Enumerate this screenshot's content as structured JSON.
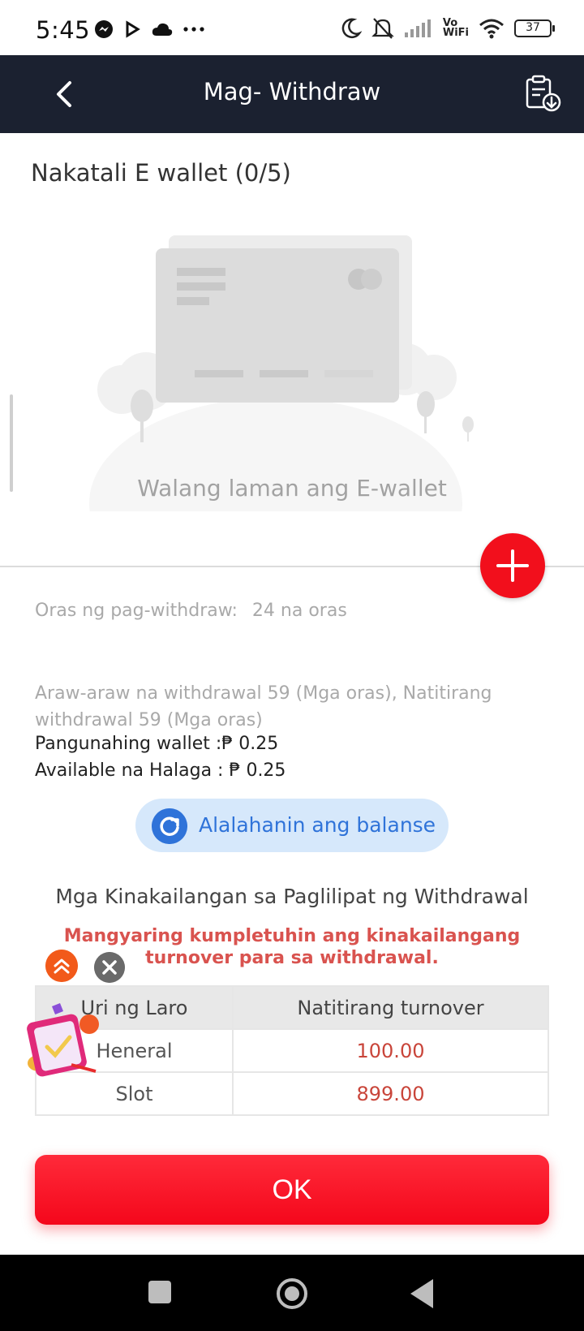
{
  "status_bar": {
    "time": "5:45",
    "left_icons": [
      "messenger-icon",
      "play-icon",
      "cloud-icon",
      "more-icon"
    ],
    "right_icons": [
      "moon-icon",
      "bell-off-icon",
      "signal-icon",
      "vowifi-icon",
      "wifi-icon",
      "battery-icon"
    ],
    "vowifi_label_top": "Vo",
    "vowifi_label_bottom": "WiFi",
    "battery": "37"
  },
  "header": {
    "title": "Mag- Withdraw",
    "back_icon": "chevron-left-icon",
    "record_icon": "clipboard-download-icon",
    "background": "#1b2130"
  },
  "wallet": {
    "title": "Nakatali E wallet (0/5)",
    "empty_text": "Walang laman ang E-wallet",
    "add_icon": "plus-icon",
    "accent": "#f20f1c"
  },
  "info": {
    "time_label": "Oras ng pag-withdraw:",
    "time_value": "24 na oras",
    "daily_text": "Araw-araw na withdrawal 59 (Mga oras), Natitirang withdrawal 59 (Mga oras)",
    "main_wallet": "Pangunahing wallet :₱ 0.25",
    "available": "Available na Halaga : ₱ 0.25"
  },
  "refresh": {
    "label": "Alalahanin ang balanse",
    "icon": "refresh-icon",
    "color": "#2f73d9"
  },
  "requirements": {
    "title": "Mga Kinakailangan sa Paglilipat ng Withdrawal",
    "warning": "Mangyaring kumpletuhin ang kinakailangang turnover para sa withdrawal.",
    "headers": [
      "Uri ng Laro",
      "Natitirang turnover"
    ],
    "rows": [
      {
        "game": "Heneral",
        "turnover": "100.00"
      },
      {
        "game": "Slot",
        "turnover": "899.00"
      }
    ]
  },
  "ok_button": {
    "label": "OK"
  },
  "floating": {
    "gift_icon": "gift-box-icon",
    "up_icon": "double-chevron-up-icon",
    "close_icon": "close-icon"
  },
  "nav": {
    "recent_icon": "square-icon",
    "home_icon": "circle-icon",
    "back_icon": "triangle-back-icon"
  }
}
